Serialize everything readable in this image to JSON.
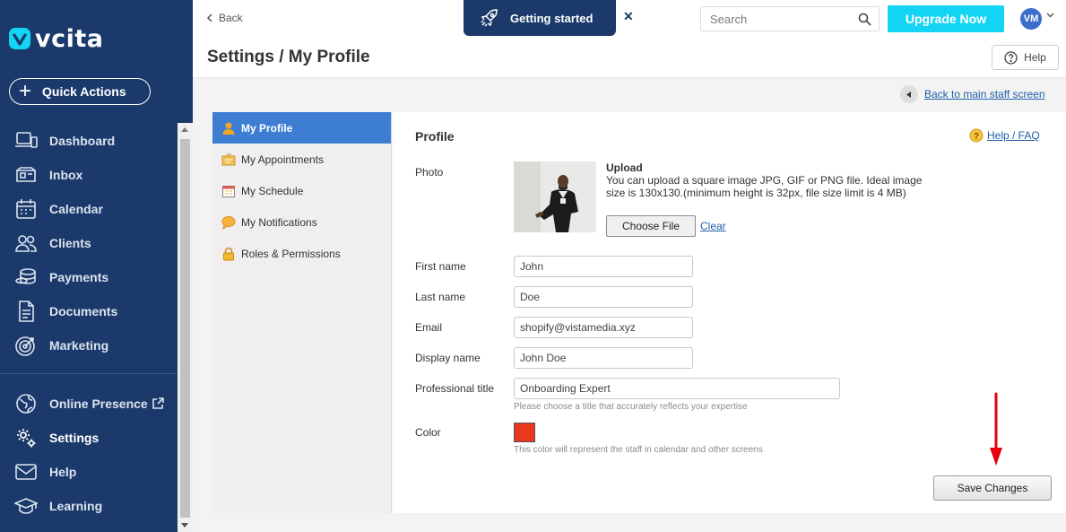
{
  "brand": {
    "name": "vcita"
  },
  "sidebar": {
    "quick_actions": "Quick Actions",
    "items": [
      {
        "label": "Dashboard",
        "icon": "dashboard-icon"
      },
      {
        "label": "Inbox",
        "icon": "inbox-icon"
      },
      {
        "label": "Calendar",
        "icon": "calendar-icon"
      },
      {
        "label": "Clients",
        "icon": "clients-icon"
      },
      {
        "label": "Payments",
        "icon": "payments-icon"
      },
      {
        "label": "Documents",
        "icon": "documents-icon"
      },
      {
        "label": "Marketing",
        "icon": "marketing-icon"
      }
    ],
    "bottom_items": [
      {
        "label": "Online Presence",
        "icon": "globe-icon"
      },
      {
        "label": "Settings",
        "icon": "settings-icon",
        "active": true
      },
      {
        "label": "Help",
        "icon": "mail-icon"
      },
      {
        "label": "Learning",
        "icon": "graduation-cap-icon"
      }
    ]
  },
  "topbar": {
    "back": "Back",
    "getting_started": "Getting started",
    "search_placeholder": "Search",
    "upgrade": "Upgrade Now",
    "avatar_initials": "VM"
  },
  "titlebar": {
    "title": "Settings / My Profile",
    "help": "Help"
  },
  "back_main": "Back to main staff screen",
  "subnav": [
    {
      "label": "My Profile",
      "active": true
    },
    {
      "label": "My Appointments"
    },
    {
      "label": "My Schedule"
    },
    {
      "label": "My Notifications"
    },
    {
      "label": "Roles & Permissions"
    }
  ],
  "profile": {
    "title": "Profile",
    "help_faq": "Help / FAQ",
    "photo_label": "Photo",
    "upload_title": "Upload",
    "upload_desc": "You can upload a square image JPG, GIF or PNG file. Ideal image size is 130x130.(minimum height is 32px, file size limit is 4 MB)",
    "choose_file": "Choose File",
    "clear": "Clear",
    "first_name_label": "First name",
    "first_name": "John",
    "last_name_label": "Last name",
    "last_name": "Doe",
    "email_label": "Email",
    "email": "shopify@vistamedia.xyz",
    "display_name_label": "Display name",
    "display_name": "John Doe",
    "professional_title_label": "Professional title",
    "professional_title": "Onboarding Expert",
    "professional_title_hint": "Please choose a title that accurately reflects your expertise",
    "color_label": "Color",
    "color_value": "#e8381f",
    "color_hint": "This color will represent the staff in calendar and other screens",
    "save": "Save Changes"
  },
  "colors": {
    "sidebar": "#1b3a6b",
    "accent": "#14d4f4",
    "active_tab": "#3d7ed3",
    "link": "#1f5fa8",
    "annotation_arrow": "#e8000b"
  }
}
